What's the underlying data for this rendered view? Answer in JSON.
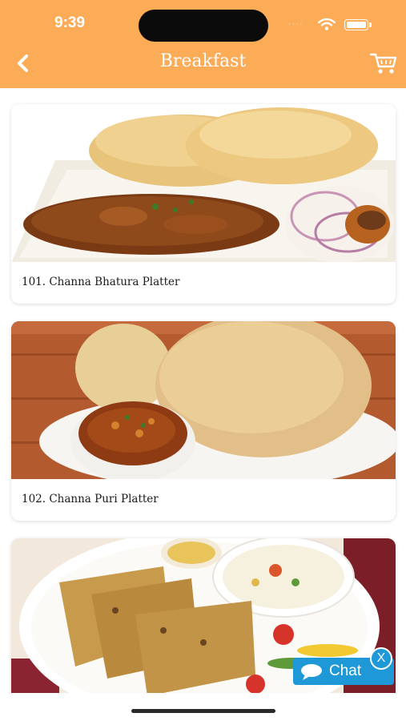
{
  "status_bar": {
    "time": "9:39"
  },
  "header": {
    "title": "Breakfast",
    "back_icon": "chevron-left-icon",
    "cart_icon": "cart-icon"
  },
  "items": [
    {
      "name": "101. Channa Bhatura Platter"
    },
    {
      "name": "102. Channa Puri Platter"
    },
    {
      "name": ""
    }
  ],
  "chat": {
    "label": "Chat",
    "close": "X"
  },
  "colors": {
    "header": "#fcab57",
    "chat": "#1e98d6",
    "text": "#1a1a1a"
  }
}
